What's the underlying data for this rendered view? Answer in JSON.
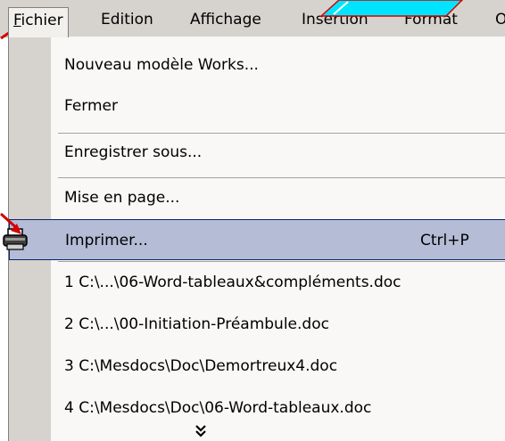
{
  "menubar": {
    "items": [
      {
        "label": "Fichier",
        "active": true
      },
      {
        "label": "Edition"
      },
      {
        "label": "Affichage"
      },
      {
        "label": "Insertion"
      },
      {
        "label": "Format"
      },
      {
        "label": "O"
      }
    ]
  },
  "menu": {
    "items": [
      {
        "label": "Nouveau modèle Works..."
      },
      {
        "label": "Fermer"
      },
      {
        "label": "Enregistrer sous..."
      },
      {
        "label": "Mise en page..."
      },
      {
        "label": "Imprimer...",
        "shortcut": "Ctrl+P",
        "icon": "printer-icon",
        "highlighted": true
      },
      {
        "label": "1 C:\\...\\06-Word-tableaux&compléments.doc"
      },
      {
        "label": "2 C:\\...\\00-Initiation-Préambule.doc"
      },
      {
        "label": "3 C:\\Mesdocs\\Doc\\Demortreux4.doc"
      },
      {
        "label": "4 C:\\Mesdocs\\Doc\\06-Word-tableaux.doc"
      }
    ],
    "expand_glyph": "»"
  },
  "colors": {
    "menubar_bg": "#d6d3ce",
    "menu_bg": "#f9f8f7",
    "highlight_bg": "#b4bcd6",
    "highlight_border": "#0a246a",
    "annotation_arrow": "#d40000",
    "annotation_cyan": "#00e5ff"
  }
}
